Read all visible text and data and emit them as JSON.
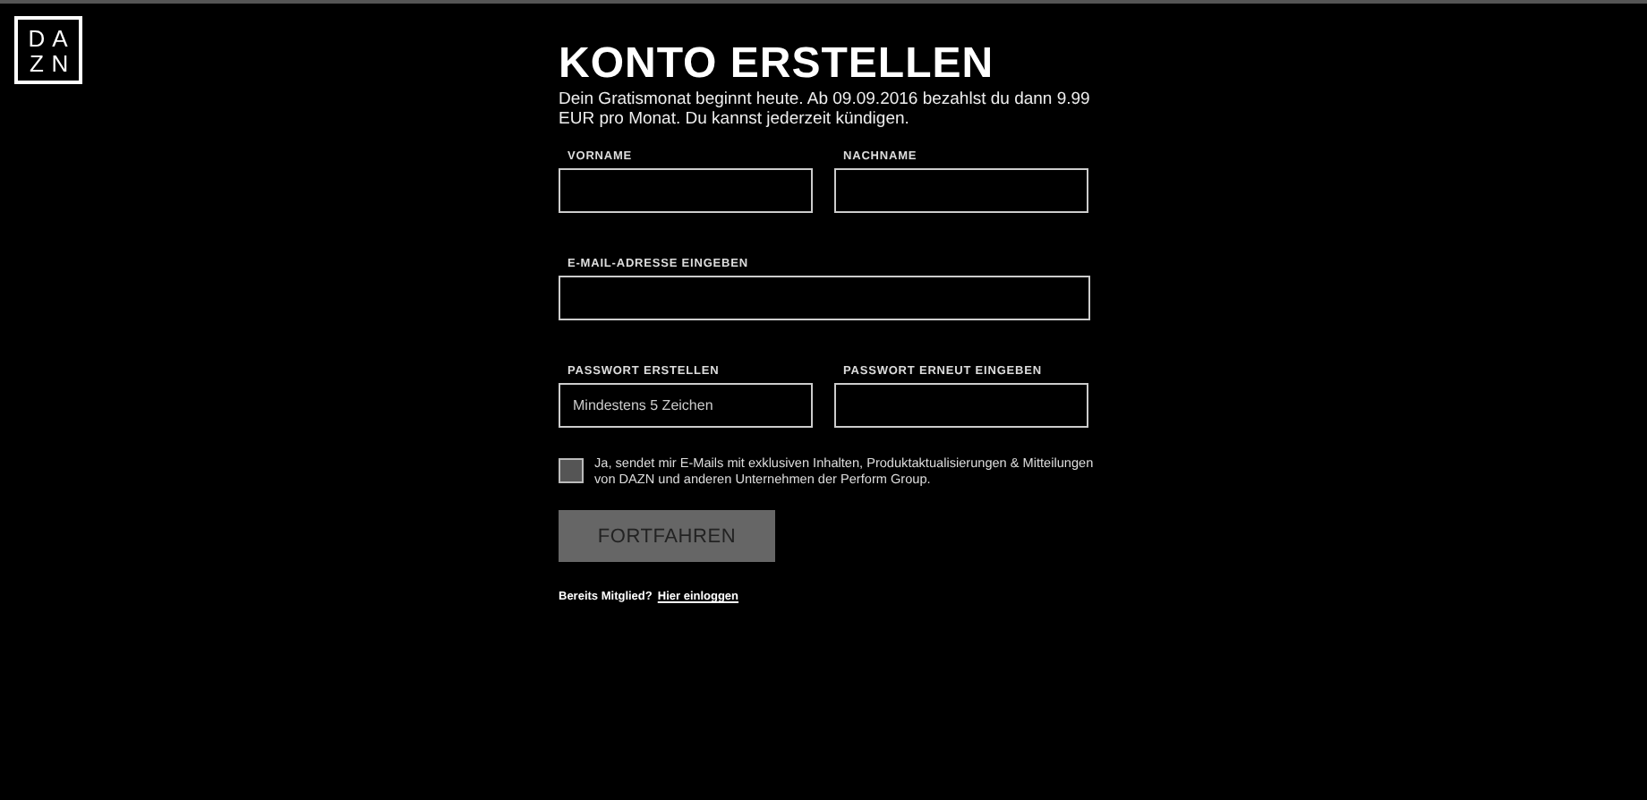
{
  "logo": {
    "letters": [
      "D",
      "A",
      "Z",
      "N"
    ]
  },
  "title": "KONTO ERSTELLEN",
  "intro": "Dein Gratismonat beginnt heute. Ab 09.09.2016 bezahlst du dann 9.99 EUR pro Monat. Du kannst jederzeit kündigen.",
  "field_rows": [
    {
      "fields": [
        {
          "label": "VORNAME"
        },
        {
          "label": "NACHNAME"
        }
      ]
    },
    {
      "fields": [
        {
          "label": "E-MAIL-ADRESSE EINGEBEN"
        }
      ]
    },
    {
      "fields": [
        {
          "label": "PASSWORT ERSTELLEN",
          "placeholder": "Mindestens 5 Zeichen"
        },
        {
          "label": "PASSWORT ERNEUT EINGEBEN"
        }
      ]
    }
  ],
  "newsletter": {
    "checked": false,
    "text": "Ja, sendet mir E-Mails mit exklusiven Inhalten, Produktaktualisierungen & Mitteilungen von DAZN und anderen Unternehmen der Perform Group."
  },
  "submit": {
    "label": "FORTFAHREN",
    "disabled": true
  },
  "login": {
    "prompt": "Bereits Mitglied?",
    "link": "Hier einloggen"
  }
}
